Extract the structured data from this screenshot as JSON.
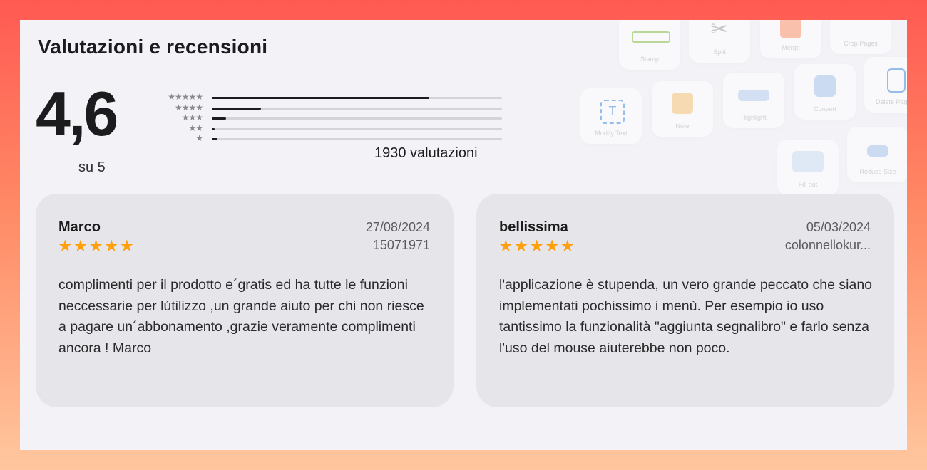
{
  "section": {
    "title": "Valutazioni e recensioni"
  },
  "summary": {
    "average": "4,6",
    "out_of": "su 5",
    "count_label": "1930 valutazioni",
    "histogram": [
      {
        "stars": "★★★★★",
        "fraction": 0.75
      },
      {
        "stars": "★★★★",
        "fraction": 0.17
      },
      {
        "stars": "★★★",
        "fraction": 0.05
      },
      {
        "stars": "★★",
        "fraction": 0.01
      },
      {
        "stars": "★",
        "fraction": 0.02
      }
    ]
  },
  "background_features": [
    {
      "label": "Stamp",
      "icon": "approved-stamp-icon",
      "color": "#8bc34a"
    },
    {
      "label": "Split",
      "icon": "scissors-icon",
      "color": "#9e9e9e"
    },
    {
      "label": "Merge",
      "icon": "merge-icon",
      "color": "#ff7043"
    },
    {
      "label": "Crop Pages",
      "icon": "crop-icon",
      "color": "#bdbdbd"
    },
    {
      "label": "Modify Text",
      "icon": "text-edit-icon",
      "color": "#4a90e2"
    },
    {
      "label": "Note",
      "icon": "note-icon",
      "color": "#f5a623"
    },
    {
      "label": "Highlight",
      "icon": "highlight-icon",
      "color": "#7aa7e0"
    },
    {
      "label": "Convert",
      "icon": "convert-icon",
      "color": "#4a90e2"
    },
    {
      "label": "Delete Pages",
      "icon": "trash-icon",
      "color": "#4a90e2"
    },
    {
      "label": "Fill out",
      "icon": "form-icon",
      "color": "#7aa7e0"
    },
    {
      "label": "Reduce Size",
      "icon": "compress-icon",
      "color": "#4a90e2"
    }
  ],
  "reviews": [
    {
      "title": "Marco",
      "stars": "★★★★★",
      "rating": 5,
      "date": "27/08/2024",
      "author": "15071971",
      "body": "complimenti per il prodotto e´gratis ed ha tutte le funzioni neccessarie per lútilizzo ,un grande aiuto per chi non riesce a pagare un´abbonamento ,grazie veramente complimenti ancora ! Marco"
    },
    {
      "title": "bellissima",
      "stars": "★★★★★",
      "rating": 5,
      "date": "05/03/2024",
      "author": "colonnellokur...",
      "body": "l'applicazione è stupenda, un vero grande peccato che siano implementati pochissimo i menù. Per esempio io uso tantissimo la funzionalità \"aggiunta segnalibro\" e farlo senza l'uso del mouse aiuterebbe non poco."
    }
  ],
  "colors": {
    "star": "#ff9f0a",
    "bar_fill": "#1c1c1e",
    "bar_track": "#d4d4d8",
    "card_bg": "#e6e6ea"
  }
}
